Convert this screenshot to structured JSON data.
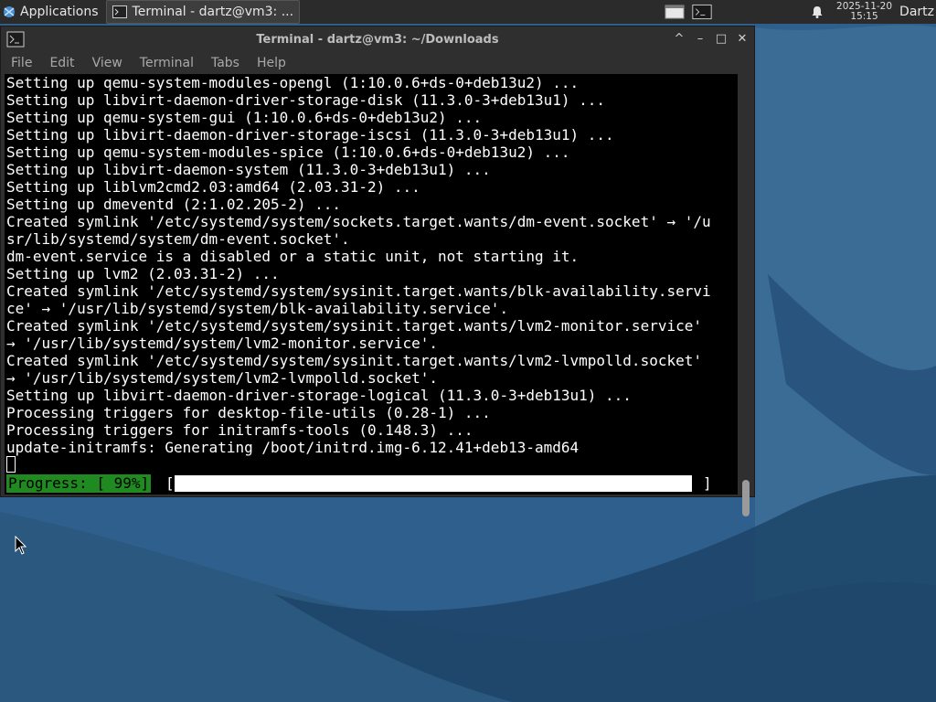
{
  "panel": {
    "applications_label": "Applications",
    "task_button_label": "Terminal - dartz@vm3: ...",
    "clock_date": "2025-11-20",
    "clock_time": "15:15",
    "user_label": "Dartz",
    "icons": [
      "applications-logo-icon",
      "terminal-task-icon",
      "show-desktop-icon",
      "terminal-launcher-icon",
      "notification-bell-icon"
    ]
  },
  "window": {
    "title": "Terminal - dartz@vm3: ~/Downloads",
    "menu": [
      "File",
      "Edit",
      "View",
      "Terminal",
      "Tabs",
      "Help"
    ],
    "controls": {
      "up": "^",
      "minimize": "–",
      "maximize": "□",
      "close": "✕"
    }
  },
  "terminal": {
    "lines": [
      "Setting up qemu-system-modules-opengl (1:10.0.6+ds-0+deb13u2) ...",
      "Setting up libvirt-daemon-driver-storage-disk (11.3.0-3+deb13u1) ...",
      "Setting up qemu-system-gui (1:10.0.6+ds-0+deb13u2) ...",
      "Setting up libvirt-daemon-driver-storage-iscsi (11.3.0-3+deb13u1) ...",
      "Setting up qemu-system-modules-spice (1:10.0.6+ds-0+deb13u2) ...",
      "Setting up libvirt-daemon-system (11.3.0-3+deb13u1) ...",
      "Setting up liblvm2cmd2.03:amd64 (2.03.31-2) ...",
      "Setting up dmeventd (2:1.02.205-2) ...",
      "Created symlink '/etc/systemd/system/sockets.target.wants/dm-event.socket' → '/u",
      "sr/lib/systemd/system/dm-event.socket'.",
      "dm-event.service is a disabled or a static unit, not starting it.",
      "Setting up lvm2 (2.03.31-2) ...",
      "Created symlink '/etc/systemd/system/sysinit.target.wants/blk-availability.servi",
      "ce' → '/usr/lib/systemd/system/blk-availability.service'.",
      "Created symlink '/etc/systemd/system/sysinit.target.wants/lvm2-monitor.service'",
      "→ '/usr/lib/systemd/system/lvm2-monitor.service'.",
      "Created symlink '/etc/systemd/system/sysinit.target.wants/lvm2-lvmpolld.socket'",
      "→ '/usr/lib/systemd/system/lvm2-lvmpolld.socket'.",
      "Setting up libvirt-daemon-driver-storage-logical (11.3.0-3+deb13u1) ...",
      "Processing triggers for desktop-file-utils (0.28-1) ...",
      "Processing triggers for initramfs-tools (0.148.3) ...",
      "update-initramfs: Generating /boot/initrd.img-6.12.41+deb13-amd64"
    ],
    "progress_label": "Progress: [ 99%]",
    "progress_bracket_left": "[",
    "progress_bracket_right": "]",
    "progress_fraction": 0.99,
    "colors": {
      "background": "#000000",
      "text": "#ffffff",
      "progress_label_bg": "#1f8a1f"
    }
  }
}
